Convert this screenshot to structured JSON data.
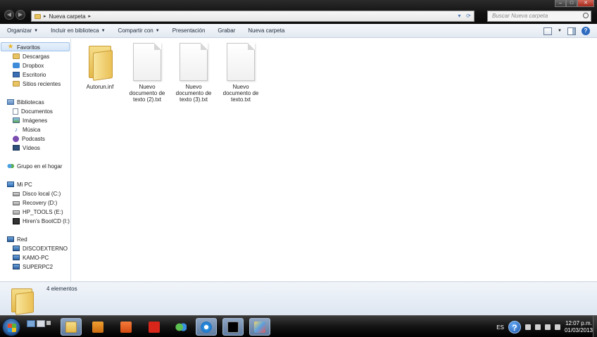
{
  "window": {
    "breadcrumb": [
      "Nueva carpeta"
    ],
    "search_placeholder": "Buscar Nueva carpeta",
    "controls": [
      "minimize",
      "maximize",
      "close"
    ]
  },
  "toolbar": {
    "items": [
      {
        "label": "Organizar",
        "dropdown": true
      },
      {
        "label": "Incluir en biblioteca",
        "dropdown": true
      },
      {
        "label": "Compartir con",
        "dropdown": true
      },
      {
        "label": "Presentación",
        "dropdown": false
      },
      {
        "label": "Grabar",
        "dropdown": false
      },
      {
        "label": "Nueva carpeta",
        "dropdown": false
      }
    ]
  },
  "sidebar": {
    "groups": [
      {
        "label": "Favoritos",
        "icon": "star-icon",
        "selected": true,
        "items": [
          {
            "label": "Descargas",
            "icon": "downloads-folder-icon"
          },
          {
            "label": "Dropbox",
            "icon": "dropbox-icon"
          },
          {
            "label": "Escritorio",
            "icon": "desktop-icon"
          },
          {
            "label": "Sitios recientes",
            "icon": "recent-places-icon"
          }
        ]
      },
      {
        "label": "Bibliotecas",
        "icon": "libraries-icon",
        "items": [
          {
            "label": "Documentos",
            "icon": "documents-icon"
          },
          {
            "label": "Imágenes",
            "icon": "pictures-icon"
          },
          {
            "label": "Música",
            "icon": "music-icon"
          },
          {
            "label": "Podcasts",
            "icon": "podcasts-icon"
          },
          {
            "label": "Vídeos",
            "icon": "videos-icon"
          }
        ]
      },
      {
        "label": "Grupo en el hogar",
        "icon": "homegroup-icon",
        "items": []
      },
      {
        "label": "Mi PC",
        "icon": "computer-icon",
        "items": [
          {
            "label": "Disco local (C:)",
            "icon": "hard-drive-icon"
          },
          {
            "label": "Recovery (D:)",
            "icon": "hard-drive-icon"
          },
          {
            "label": "HP_TOOLS (E:)",
            "icon": "hard-drive-icon"
          },
          {
            "label": "Hiren's BootCD (I:)",
            "icon": "cd-drive-icon"
          }
        ]
      },
      {
        "label": "Red",
        "icon": "network-icon",
        "items": [
          {
            "label": "DISCOEXTERNO",
            "icon": "network-computer-icon"
          },
          {
            "label": "KAMO-PC",
            "icon": "network-computer-icon"
          },
          {
            "label": "SUPERPC2",
            "icon": "network-computer-icon"
          }
        ]
      }
    ]
  },
  "files": [
    {
      "name": "Autorun.inf",
      "icon": "folder-icon"
    },
    {
      "name": "Nuevo documento de texto (2).txt",
      "icon": "text-file-icon"
    },
    {
      "name": "Nuevo documento de texto (3).txt",
      "icon": "text-file-icon"
    },
    {
      "name": "Nuevo documento de texto.txt",
      "icon": "text-file-icon"
    }
  ],
  "details": {
    "count_text": "4 elementos"
  },
  "taskbar": {
    "language": "ES",
    "time": "12:07 p.m.",
    "date": "01/03/2013"
  },
  "colors": {
    "titlebar": "#111111",
    "toolbar": "#e3e9f2",
    "selection": "#d5e6f8",
    "folder": "#e5b94a"
  }
}
